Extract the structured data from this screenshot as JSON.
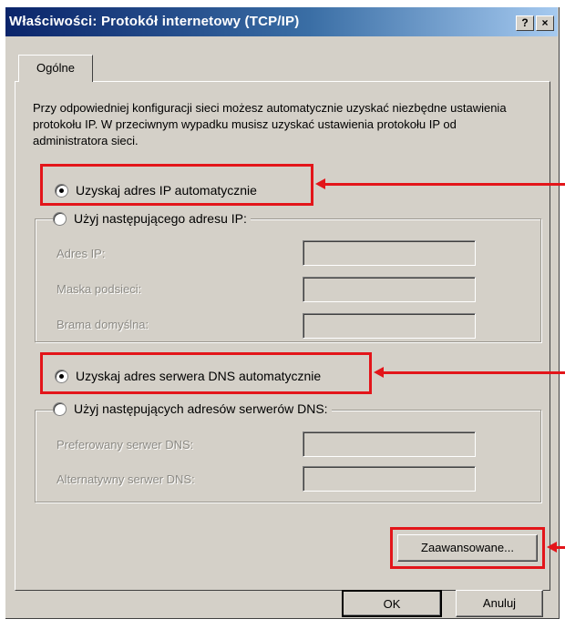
{
  "window": {
    "title": "Właściwości: Protokół internetowy (TCP/IP)",
    "help_button": "?",
    "close_button": "×"
  },
  "tabs": [
    {
      "label": "Ogólne",
      "active": true
    }
  ],
  "description": "Przy odpowiedniej konfiguracji sieci możesz automatycznie uzyskać niezbędne ustawienia protokołu IP. W przeciwnym wypadku musisz uzyskać ustawienia protokołu IP od administratora sieci.",
  "ip": {
    "auto_label": "Uzyskaj adres IP automatycznie",
    "auto_selected": true,
    "manual_label": "Użyj następującego adresu IP:",
    "manual_selected": false,
    "fields": [
      {
        "label": "Adres IP:",
        "value": ""
      },
      {
        "label": "Maska podsieci:",
        "value": ""
      },
      {
        "label": "Brama domyślna:",
        "value": ""
      }
    ]
  },
  "dns": {
    "auto_label": "Uzyskaj adres serwera DNS automatycznie",
    "auto_selected": true,
    "manual_label": "Użyj następujących adresów serwerów DNS:",
    "manual_selected": false,
    "fields": [
      {
        "label": "Preferowany serwer DNS:",
        "value": ""
      },
      {
        "label": "Alternatywny serwer DNS:",
        "value": ""
      }
    ]
  },
  "buttons": {
    "advanced": "Zaawansowane...",
    "ok": "OK",
    "cancel": "Anuluj"
  },
  "colors": {
    "highlight": "#e3151a",
    "title_bar": "#0a246a",
    "face": "#d4d0c8"
  }
}
